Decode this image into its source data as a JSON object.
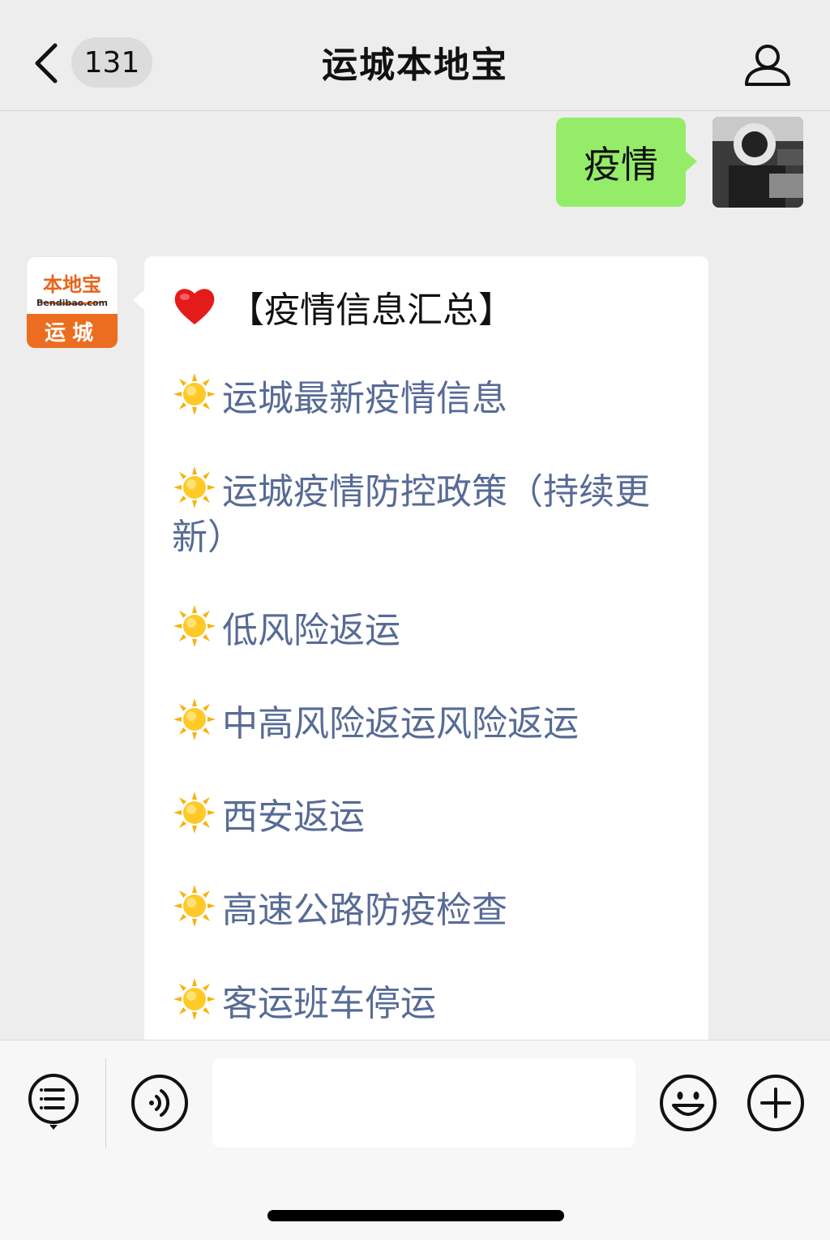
{
  "header": {
    "back_icon": "chevron-left-icon",
    "unread_count": "131",
    "title": "运城本地宝",
    "profile_icon": "person-icon"
  },
  "messages": {
    "sent": {
      "text": "疫情"
    },
    "received": {
      "avatar": {
        "brand": "本地宝",
        "domain": "Bendibao.com",
        "city": "运城"
      },
      "heading_icon": "heart-icon",
      "heading": "【疫情信息汇总】",
      "item_icon": "sun-icon",
      "items": [
        "运城最新疫情信息",
        "运城疫情防控政策（持续更新）",
        "低风险返运",
        "中高风险返运风险返运",
        "西安返运",
        "高速公路防疫检查",
        "客运班车停运"
      ]
    }
  },
  "footer": {
    "menu_icon": "list-menu-icon",
    "voice_icon": "voice-icon",
    "input_value": "",
    "emoji_icon": "smiley-icon",
    "plus_icon": "plus-icon"
  },
  "colors": {
    "background": "#ededed",
    "sent_bubble": "#95ec69",
    "link": "#576b95",
    "brand_orange": "#ec6d1f"
  }
}
